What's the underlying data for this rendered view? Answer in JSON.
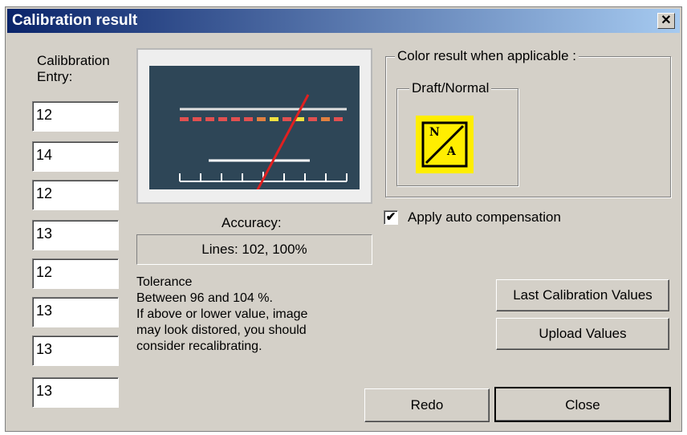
{
  "window": {
    "title": "Calibration result",
    "close_glyph": "✕"
  },
  "entries": {
    "label_line1": "Calibbration",
    "label_line2": "Entry:",
    "values": [
      "12",
      "14",
      "12",
      "13",
      "12",
      "13",
      "13",
      "13"
    ]
  },
  "meter": {
    "caption": "Accuracy:",
    "readout": "Lines: 102,    100%",
    "needle_color": "#e02020",
    "face_color": "#2e4657"
  },
  "tolerance": {
    "line1": "Tolerance",
    "line2": "Between 96 and 104 %.",
    "line3": "If above or lower value, image",
    "line4": "may look distored, you should",
    "line5": "consider recalibrating."
  },
  "color_result": {
    "group_label": "Color result when applicable :",
    "mode_label": "Draft/Normal",
    "na_top": "N",
    "na_bottom": "A",
    "na_color": "#ffee00"
  },
  "auto_compensation": {
    "label": "Apply auto compensation",
    "checked": true,
    "check_glyph": "✔"
  },
  "buttons": {
    "last_values": "Last Calibration Values",
    "upload": "Upload Values",
    "redo": "Redo",
    "close": "Close"
  }
}
